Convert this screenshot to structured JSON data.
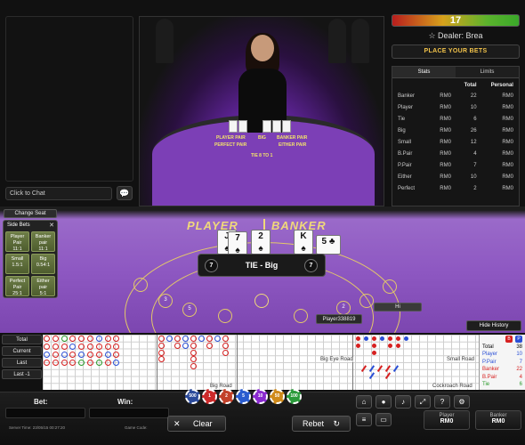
{
  "chat": {
    "placeholder": "Click to Chat",
    "send_icon": "speech-bubble-icon"
  },
  "timer": {
    "value": "17"
  },
  "dealer": {
    "label": "Dealer: Brea"
  },
  "status": {
    "message": "PLACE YOUR BETS"
  },
  "stats": {
    "tabs": [
      "Stats",
      "Limits"
    ],
    "headers": {
      "total": "Total",
      "personal": "Personal"
    },
    "rows": [
      {
        "name": "Banker",
        "cur": "RM0",
        "total": "22",
        "personal": "RM0"
      },
      {
        "name": "Player",
        "cur": "RM0",
        "total": "10",
        "personal": "RM0"
      },
      {
        "name": "Tie",
        "cur": "RM0",
        "total": "6",
        "personal": "RM0"
      },
      {
        "name": "Big",
        "cur": "RM0",
        "total": "26",
        "personal": "RM0"
      },
      {
        "name": "Small",
        "cur": "RM0",
        "total": "12",
        "personal": "RM0"
      },
      {
        "name": "B.Pair",
        "cur": "RM0",
        "total": "4",
        "personal": "RM0"
      },
      {
        "name": "P.Pair",
        "cur": "RM0",
        "total": "7",
        "personal": "RM0"
      },
      {
        "name": "Either",
        "cur": "RM0",
        "total": "10",
        "personal": "RM0"
      },
      {
        "name": "Perfect",
        "cur": "RM0",
        "total": "2",
        "personal": "RM0"
      }
    ]
  },
  "video": {
    "labels": {
      "player_pair": "PLAYER PAIR",
      "big": "BIG",
      "banker_pair": "BANKER PAIR",
      "perfect_pair": "PERFECT PAIR",
      "either_pair": "EITHER PAIR",
      "tie": "TIE 8 TO 1"
    }
  },
  "table": {
    "player_label": "PLAYER",
    "banker_label": "BANKER",
    "player_cards": [
      "J",
      "7"
    ],
    "banker_cards": [
      "K",
      "5"
    ],
    "extra_card": "2",
    "player_score": "7",
    "banker_score": "7",
    "result": "TIE - Big",
    "ring_numbers": [
      "3",
      "5",
      "2"
    ],
    "player_tag": "Player338819",
    "hi_tag": "Hi",
    "hide_history": "Hide History"
  },
  "side_bets": {
    "change_seat": "Change Seat",
    "title": "Side Bets",
    "close": "✕",
    "cells": [
      {
        "name": "Player Pair",
        "odds": "11:1"
      },
      {
        "name": "Banker pair",
        "odds": "11:1"
      },
      {
        "name": "Small",
        "odds": "1.5:1"
      },
      {
        "name": "Big",
        "odds": "0.54:1"
      },
      {
        "name": "Perfect Pair",
        "odds": "25:1"
      },
      {
        "name": "Either pair",
        "odds": "5:1"
      }
    ]
  },
  "road": {
    "buttons": [
      "Total",
      "Current",
      "Last",
      "Last -1"
    ],
    "labels": {
      "big_road": "Big Road",
      "big_eye": "Big Eye Road",
      "small": "Small Road",
      "cockroach": "Cockroach Road"
    },
    "summary": [
      {
        "label": "Total",
        "value": "38",
        "color": "#000000"
      },
      {
        "label": "Player",
        "value": "10",
        "color": "#2a4fd6"
      },
      {
        "label": "P.Pair",
        "value": "7",
        "color": "#2a4fd6"
      },
      {
        "label": "Banker",
        "value": "22",
        "color": "#d62020"
      },
      {
        "label": "B.Pair",
        "value": "4",
        "color": "#d62020"
      },
      {
        "label": "Tie",
        "value": "6",
        "color": "#2a9a2a"
      }
    ],
    "badges": [
      "B",
      "P"
    ]
  },
  "bottom": {
    "bet_label": "Bet:",
    "win_label": "Win:",
    "server_time": "Server Time: 23/05/15 00:27:20",
    "game_code": "Game Code:",
    "clear": "Clear",
    "rebet": "Rebet",
    "chips": [
      {
        "label": "500",
        "color": "#2b4a9a"
      },
      {
        "label": "1",
        "color": "#cc2a2a"
      },
      {
        "label": "2",
        "color": "#c2412a"
      },
      {
        "label": "5",
        "color": "#2a5ccf"
      },
      {
        "label": "10",
        "color": "#8a2acf"
      },
      {
        "label": "50",
        "color": "#cf8a1a"
      },
      {
        "label": "100",
        "color": "#2a9a3a"
      }
    ],
    "player_total": {
      "title": "Player",
      "value": "RM0"
    },
    "banker_total": {
      "title": "Banker",
      "value": "RM0"
    }
  },
  "colors": {
    "felt": "#8e58c2",
    "gold": "#f0d97a",
    "banker": "#d62020",
    "player": "#2a4fd6",
    "tie": "#2a9a2a"
  }
}
